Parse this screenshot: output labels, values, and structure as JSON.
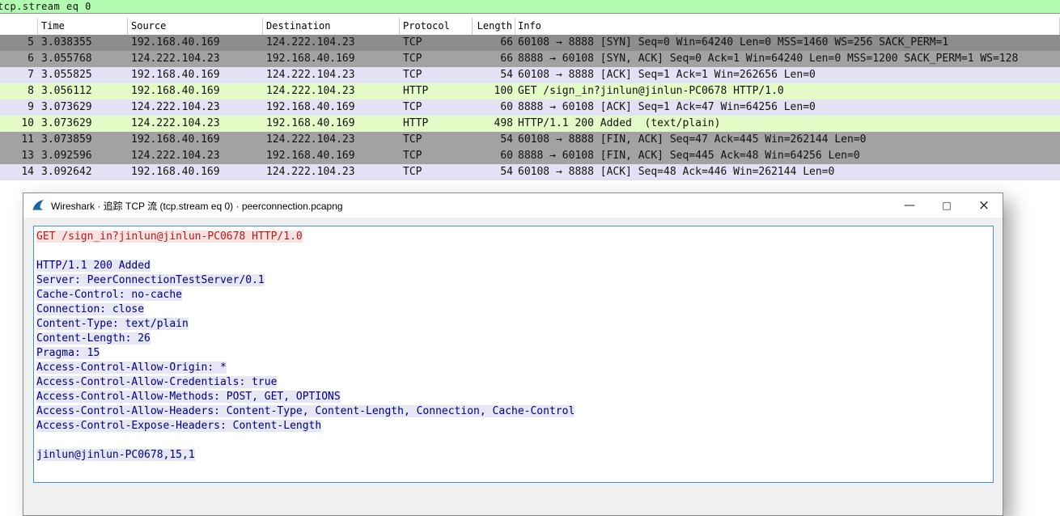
{
  "filter_bar": {
    "text": "tcp.stream eq 0"
  },
  "packet_list": {
    "columns": [
      "",
      "Time",
      "Source",
      "Destination",
      "Protocol",
      "Length",
      "Info"
    ],
    "rows": [
      {
        "no": "5",
        "time": "3.038355",
        "source": "192.168.40.169",
        "destination": "124.222.104.23",
        "protocol": "TCP",
        "length": "66",
        "info": "60108 → 8888 [SYN] Seq=0 Win=64240 Len=0 MSS=1460 WS=256 SACK_PERM=1",
        "bg": "row_gray_selected"
      },
      {
        "no": "6",
        "time": "3.055768",
        "source": "124.222.104.23",
        "destination": "192.168.40.169",
        "protocol": "TCP",
        "length": "66",
        "info": "8888 → 60108 [SYN, ACK] Seq=0 Ack=1 Win=64240 Len=0 MSS=1200 SACK_PERM=1 WS=128",
        "bg": "row_gray"
      },
      {
        "no": "7",
        "time": "3.055825",
        "source": "192.168.40.169",
        "destination": "124.222.104.23",
        "protocol": "TCP",
        "length": "54",
        "info": "60108 → 8888 [ACK] Seq=1 Ack=1 Win=262656 Len=0",
        "bg": "row_tcp_lavender"
      },
      {
        "no": "8",
        "time": "3.056112",
        "source": "192.168.40.169",
        "destination": "124.222.104.23",
        "protocol": "HTTP",
        "length": "100",
        "info": "GET /sign_in?jinlun@jinlun-PC0678 HTTP/1.0",
        "bg": "row_http_green"
      },
      {
        "no": "9",
        "time": "3.073629",
        "source": "124.222.104.23",
        "destination": "192.168.40.169",
        "protocol": "TCP",
        "length": "60",
        "info": "8888 → 60108 [ACK] Seq=1 Ack=47 Win=64256 Len=0",
        "bg": "row_tcp_lavender"
      },
      {
        "no": "10",
        "time": "3.073629",
        "source": "124.222.104.23",
        "destination": "192.168.40.169",
        "protocol": "HTTP",
        "length": "498",
        "info": "HTTP/1.1 200 Added  (text/plain)",
        "bg": "row_http_green"
      },
      {
        "no": "11",
        "time": "3.073859",
        "source": "192.168.40.169",
        "destination": "124.222.104.23",
        "protocol": "TCP",
        "length": "54",
        "info": "60108 → 8888 [FIN, ACK] Seq=47 Ack=445 Win=262144 Len=0",
        "bg": "row_gray"
      },
      {
        "no": "13",
        "time": "3.092596",
        "source": "124.222.104.23",
        "destination": "192.168.40.169",
        "protocol": "TCP",
        "length": "60",
        "info": "8888 → 60108 [FIN, ACK] Seq=445 Ack=48 Win=64256 Len=0",
        "bg": "row_gray"
      },
      {
        "no": "14",
        "time": "3.092642",
        "source": "192.168.40.169",
        "destination": "124.222.104.23",
        "protocol": "TCP",
        "length": "54",
        "info": "60108 → 8888 [ACK] Seq=48 Ack=446 Win=262144 Len=0",
        "bg": "row_tcp_lavender"
      }
    ]
  },
  "dialog": {
    "title": "Wireshark · 追踪 TCP 流 (tcp.stream eq 0) · peerconnection.pcapng",
    "controls": {
      "minimize": "—",
      "maximize": "□",
      "close": "×"
    },
    "stream": {
      "lines": [
        {
          "direction": "client",
          "text": "GET /sign_in?jinlun@jinlun-PC0678 HTTP/1.0"
        },
        {
          "direction": "none",
          "text": ""
        },
        {
          "direction": "server",
          "text": "HTTP/1.1 200 Added"
        },
        {
          "direction": "server",
          "text": "Server: PeerConnectionTestServer/0.1"
        },
        {
          "direction": "server",
          "text": "Cache-Control: no-cache"
        },
        {
          "direction": "server",
          "text": "Connection: close"
        },
        {
          "direction": "server",
          "text": "Content-Type: text/plain"
        },
        {
          "direction": "server",
          "text": "Content-Length: 26"
        },
        {
          "direction": "server",
          "text": "Pragma: 15"
        },
        {
          "direction": "server",
          "text": "Access-Control-Allow-Origin: *"
        },
        {
          "direction": "server",
          "text": "Access-Control-Allow-Credentials: true"
        },
        {
          "direction": "server",
          "text": "Access-Control-Allow-Methods: POST, GET, OPTIONS"
        },
        {
          "direction": "server",
          "text": "Access-Control-Allow-Headers: Content-Type, Content-Length, Connection, Cache-Control"
        },
        {
          "direction": "server",
          "text": "Access-Control-Expose-Headers: Content-Length"
        },
        {
          "direction": "none",
          "text": ""
        },
        {
          "direction": "server",
          "text": "jinlun@jinlun-PC0678,15,1"
        }
      ]
    }
  },
  "colors": {
    "filter_bar_bg": "#b2fcb2",
    "row_gray_selected": "#8d8d8d",
    "row_gray": "#a2a2a2",
    "row_tcp_lavender": "#e2e2f4",
    "row_http_green": "#e4fbc7",
    "client_text": "#b01c1c",
    "client_bg": "#f7e2e2",
    "server_text": "#00007e",
    "server_bg": "#e6e6f4",
    "textbox_border": "#4a90d2",
    "titlebar_bg": "#ffffff",
    "dialog_bg": "#f0f0f0",
    "wireshark_blue": "#1769aa"
  }
}
